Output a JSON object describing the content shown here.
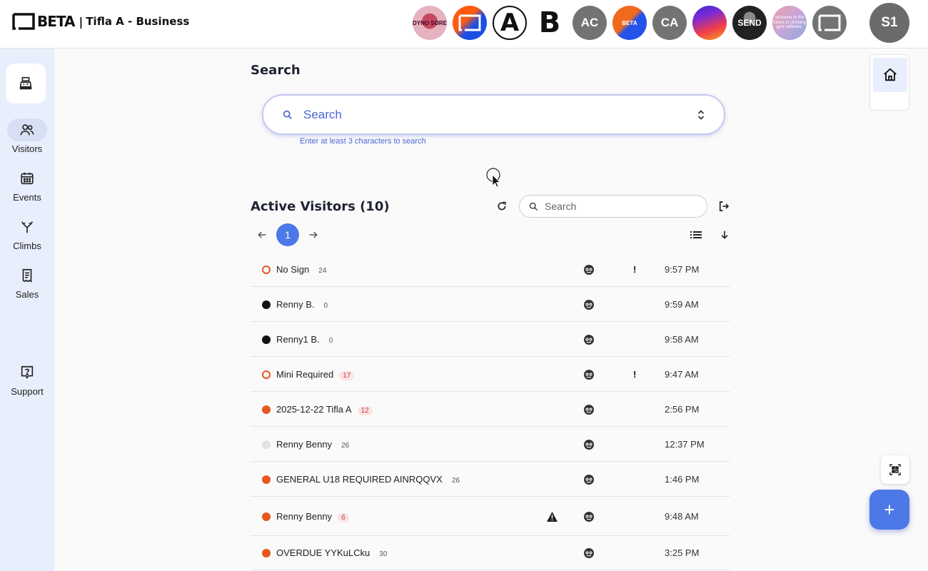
{
  "header": {
    "logo_word": "BETA",
    "separator": "|",
    "business_name": "Tifla A - Business",
    "gyms": [
      {
        "label": "DYNO SORE",
        "style": "boulder"
      },
      {
        "label": "",
        "style": "blue"
      },
      {
        "label": "A",
        "style": "a"
      },
      {
        "label": "B",
        "style": "b"
      },
      {
        "label": "AC",
        "style": "gray"
      },
      {
        "label": "BETA",
        "style": "beta"
      },
      {
        "label": "CA",
        "style": "gray"
      },
      {
        "label": "",
        "style": "grad"
      },
      {
        "label": "SEND",
        "style": "send"
      },
      {
        "label": "welcome to the future of climbing gym software.",
        "style": "welcome"
      },
      {
        "label": "",
        "style": "logo"
      }
    ],
    "user_initials": "S1"
  },
  "sidebar": {
    "items": [
      {
        "label": "Visitors",
        "icon": "users-icon",
        "active": true
      },
      {
        "label": "Events",
        "icon": "calendar-icon",
        "active": false
      },
      {
        "label": "Climbs",
        "icon": "route-split-icon",
        "active": false
      },
      {
        "label": "Sales",
        "icon": "receipt-icon",
        "active": false
      },
      {
        "label": "Support",
        "icon": "help-icon",
        "active": false
      }
    ]
  },
  "search": {
    "title": "Search",
    "placeholder": "Search",
    "helper": "Enter at least 3 characters to search"
  },
  "visitors": {
    "title": "Active Visitors (10)",
    "search_placeholder": "Search",
    "current_page": "1",
    "rows": [
      {
        "name": "No Sign",
        "count": "24",
        "status": "ring",
        "badge_style": "plain",
        "alert": true,
        "warning": false,
        "time": "9:57 PM"
      },
      {
        "name": "Renny B.",
        "count": "0",
        "status": "black",
        "badge_style": "plain",
        "alert": false,
        "warning": false,
        "time": "9:59 AM"
      },
      {
        "name": "Renny1 B.",
        "count": "0",
        "status": "black",
        "badge_style": "plain",
        "alert": false,
        "warning": false,
        "time": "9:58 AM"
      },
      {
        "name": "Mini Required",
        "count": "17",
        "status": "ring",
        "badge_style": "pink",
        "alert": true,
        "warning": false,
        "time": "9:47 AM"
      },
      {
        "name": "2025-12-22 Tifla A",
        "count": "12",
        "status": "orange",
        "badge_style": "pink",
        "alert": false,
        "warning": false,
        "time": "2:56 PM"
      },
      {
        "name": "Renny Benny",
        "count": "26",
        "status": "light",
        "badge_style": "plain",
        "alert": false,
        "warning": false,
        "time": "12:37 PM"
      },
      {
        "name": "GENERAL U18 REQUIRED AINRQQVX",
        "count": "26",
        "status": "orange",
        "badge_style": "plain",
        "alert": false,
        "warning": false,
        "time": "1:46 PM"
      },
      {
        "name": "Renny Benny",
        "count": "6",
        "status": "orange",
        "badge_style": "pink",
        "alert": false,
        "warning": true,
        "time": "9:48 AM"
      },
      {
        "name": "OVERDUE YYKuLCku",
        "count": "30",
        "status": "orange",
        "badge_style": "plain",
        "alert": false,
        "warning": false,
        "time": "3:25 PM"
      }
    ]
  },
  "actions": {
    "fab_label": "+"
  },
  "colors": {
    "accent": "#4d78e8",
    "status_orange": "#e8581e",
    "sidebar_bg": "#e8eefb"
  }
}
